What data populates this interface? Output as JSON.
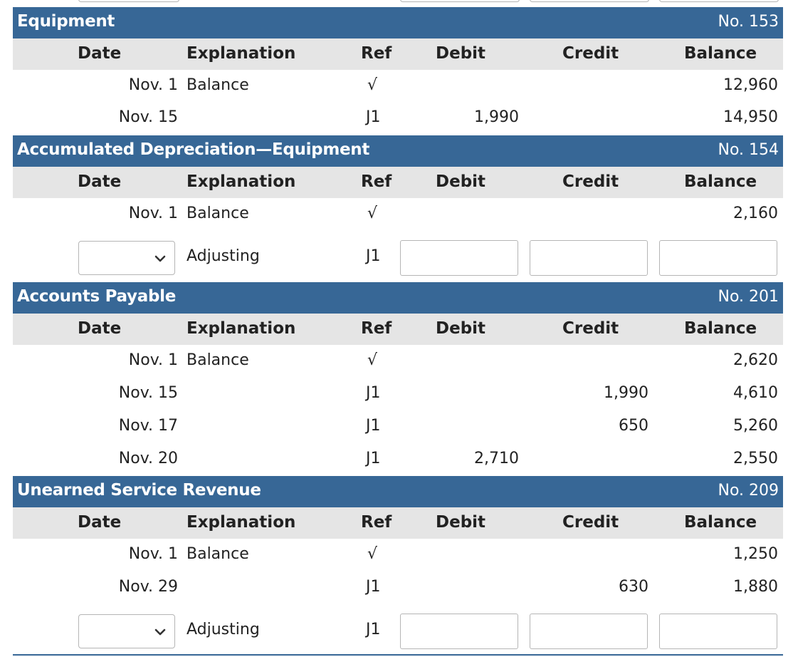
{
  "columns": [
    "Date",
    "Explanation",
    "Ref",
    "Debit",
    "Credit",
    "Balance"
  ],
  "ledgers": [
    {
      "name": "Equipment",
      "number": "No. 153",
      "rows": [
        {
          "date": "Nov. 1",
          "explanation": "Balance",
          "ref": "√",
          "debit": "",
          "credit": "",
          "balance": "12,960"
        },
        {
          "date": "Nov. 15",
          "explanation": "",
          "ref": "J1",
          "debit": "1,990",
          "credit": "",
          "balance": "14,950"
        }
      ]
    },
    {
      "name": "Accumulated Depreciation—Equipment",
      "number": "No. 154",
      "rows": [
        {
          "date": "Nov. 1",
          "explanation": "Balance",
          "ref": "√",
          "debit": "",
          "credit": "",
          "balance": "2,160"
        }
      ],
      "adjusting": {
        "date_selected": "",
        "explanation": "Adjusting",
        "ref": "J1",
        "debit": "",
        "credit": "",
        "balance": ""
      }
    },
    {
      "name": "Accounts Payable",
      "number": "No. 201",
      "rows": [
        {
          "date": "Nov. 1",
          "explanation": "Balance",
          "ref": "√",
          "debit": "",
          "credit": "",
          "balance": "2,620"
        },
        {
          "date": "Nov. 15",
          "explanation": "",
          "ref": "J1",
          "debit": "",
          "credit": "1,990",
          "balance": "4,610"
        },
        {
          "date": "Nov. 17",
          "explanation": "",
          "ref": "J1",
          "debit": "",
          "credit": "650",
          "balance": "5,260"
        },
        {
          "date": "Nov. 20",
          "explanation": "",
          "ref": "J1",
          "debit": "2,710",
          "credit": "",
          "balance": "2,550"
        }
      ]
    },
    {
      "name": "Unearned Service Revenue",
      "number": "No. 209",
      "rows": [
        {
          "date": "Nov. 1",
          "explanation": "Balance",
          "ref": "√",
          "debit": "",
          "credit": "",
          "balance": "1,250"
        },
        {
          "date": "Nov. 29",
          "explanation": "",
          "ref": "J1",
          "debit": "",
          "credit": "630",
          "balance": "1,880"
        }
      ],
      "adjusting": {
        "date_selected": "",
        "explanation": "Adjusting",
        "ref": "J1",
        "debit": "",
        "credit": "",
        "balance": ""
      }
    }
  ],
  "icons": {
    "date_dropdown": "chevron-down-icon"
  },
  "colors": {
    "header_bg": "#376796",
    "column_header_bg": "#e5e5e5",
    "input_border": "#b5b5b5"
  }
}
